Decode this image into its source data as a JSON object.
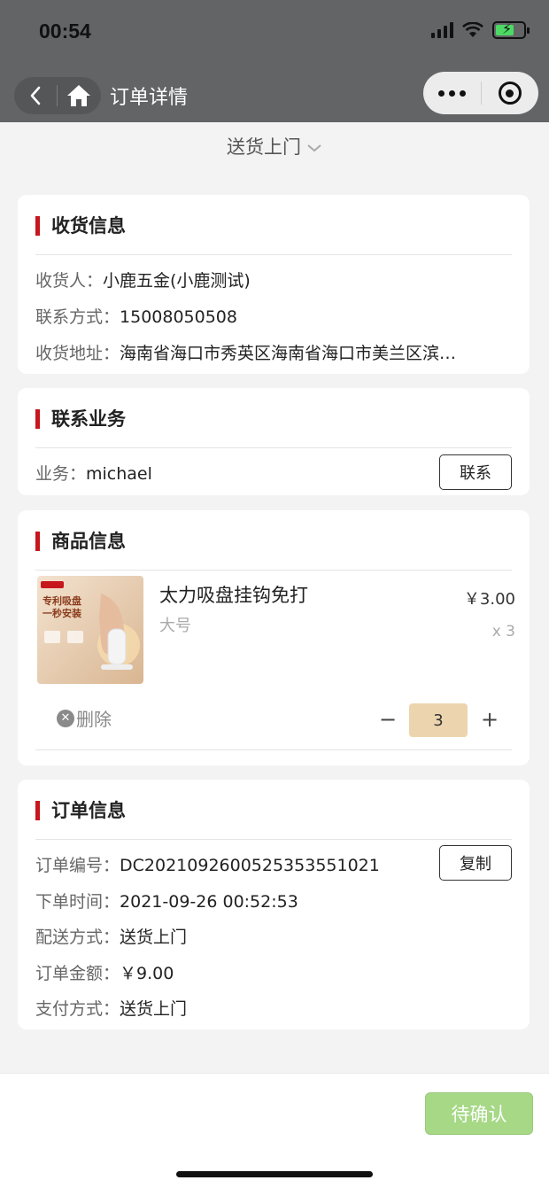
{
  "status_bar": {
    "time": "00:54"
  },
  "nav": {
    "title": "订单详情"
  },
  "delivery_mode": "送货上门",
  "receiver": {
    "title": "收货信息",
    "name_label": "收货人：",
    "name": "小鹿五金(小鹿测试)",
    "phone_label": "联系方式：",
    "phone": "15008050508",
    "address_label": "收货地址：",
    "address": "海南省海口市秀英区海南省海口市美兰区滨…"
  },
  "sales": {
    "title": "联系业务",
    "label": "业务：",
    "name": "michael",
    "contact_button": "联系"
  },
  "product": {
    "title": "商品信息",
    "image_text_1": "专利吸盘",
    "image_text_2": "一秒安装",
    "name": "太力吸盘挂钩免打",
    "spec": "大号",
    "price": "￥3.00",
    "count_text": "x 3",
    "delete_label": "删除",
    "minus": "−",
    "quantity": "3",
    "plus": "+"
  },
  "order": {
    "title": "订单信息",
    "number_label": "订单编号：",
    "number": "DC20210926005253535510​21",
    "copy_button": "复制",
    "time_label": "下单时间：",
    "time": "2021-09-26 00:52:53",
    "shipping_label": "配送方式：",
    "shipping": "送货上门",
    "amount_label": "订单金额：",
    "amount": "￥9.00",
    "payment_label": "支付方式：",
    "payment": "送货上门"
  },
  "footer": {
    "confirm_button": "待确认"
  },
  "colors": {
    "accent_red": "#c8161d",
    "confirm_green": "#a6d886",
    "qty_bg": "#ecd5ae",
    "topbar": "#636466"
  },
  "icons": [
    "signal-icon",
    "wifi-icon",
    "battery-icon",
    "back-icon",
    "home-icon",
    "more-icon",
    "close-circle-icon",
    "chevron-down-icon",
    "delete-circle-icon"
  ]
}
